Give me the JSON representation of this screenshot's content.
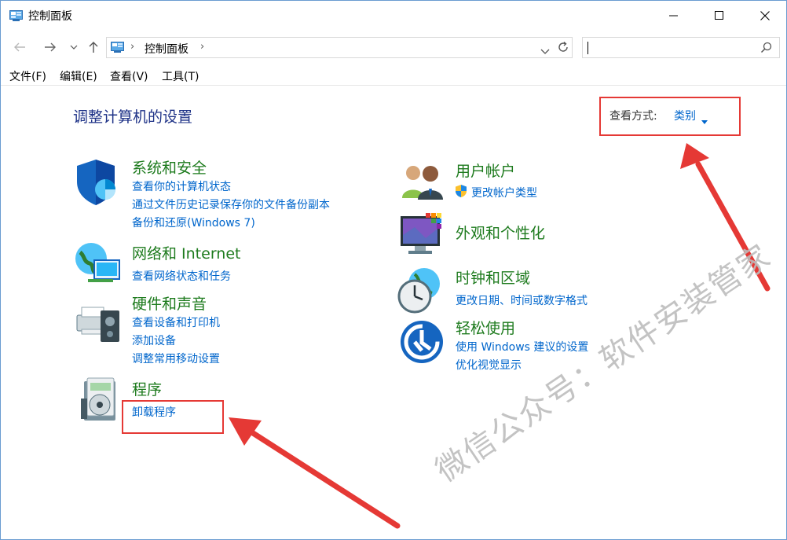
{
  "window": {
    "title": "控制面板",
    "controls": {
      "minimize": "minimize-icon",
      "maximize": "maximize-icon",
      "close": "close-icon"
    }
  },
  "nav": {
    "back": "back-arrow-icon",
    "forward": "forward-arrow-icon",
    "recent": "chevron-down-icon",
    "up": "up-arrow-icon"
  },
  "address": {
    "crumbs": [
      "控制面板"
    ],
    "separator": "›",
    "dropdown": "chevron-down-icon",
    "refresh": "refresh-icon"
  },
  "search": {
    "value": "",
    "placeholder": "",
    "icon": "search-icon"
  },
  "menu": [
    "文件(F)",
    "编辑(E)",
    "查看(V)",
    "工具(T)"
  ],
  "main": {
    "heading": "调整计算机的设置",
    "view_by": {
      "label": "查看方式:",
      "value": "类别"
    },
    "categories_left": [
      {
        "title": "系统和安全",
        "icon": "shield-icon",
        "links": [
          "查看你的计算机状态",
          "通过文件历史记录保存你的文件备份副本",
          "备份和还原(Windows 7)"
        ]
      },
      {
        "title": "网络和 Internet",
        "icon": "network-globe-icon",
        "links": [
          "查看网络状态和任务"
        ]
      },
      {
        "title": "硬件和声音",
        "icon": "printer-speaker-icon",
        "links": [
          "查看设备和打印机",
          "添加设备",
          "调整常用移动设置"
        ]
      },
      {
        "title": "程序",
        "icon": "programs-disc-icon",
        "links": [
          "卸载程序"
        ]
      }
    ],
    "categories_right": [
      {
        "title": "用户帐户",
        "icon": "users-icon",
        "links": [
          "更改帐户类型"
        ]
      },
      {
        "title": "外观和个性化",
        "icon": "monitor-palette-icon",
        "links": []
      },
      {
        "title": "时钟和区域",
        "icon": "clock-globe-icon",
        "links": [
          "更改日期、时间或数字格式"
        ]
      },
      {
        "title": "轻松使用",
        "icon": "ease-of-access-icon",
        "links": [
          "使用 Windows 建议的设置",
          "优化视觉显示"
        ]
      }
    ]
  },
  "watermark": "微信公众号：软件安装管家",
  "colors": {
    "heading": "#1e3287",
    "category_title": "#1e7b1e",
    "link": "#0066cc",
    "highlight": "#e53935"
  }
}
